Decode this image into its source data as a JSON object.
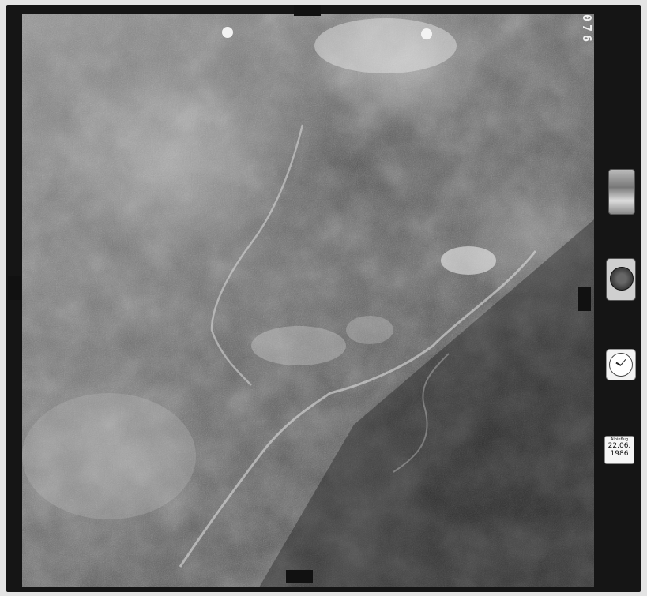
{
  "frame_number": "076",
  "date_card": {
    "header": "Alpinflug",
    "date": "22.06.",
    "year": "1986"
  },
  "colors": {
    "film_border": "#151515",
    "background": "#e4e4e4",
    "fiducial": "#f2f2f2"
  }
}
